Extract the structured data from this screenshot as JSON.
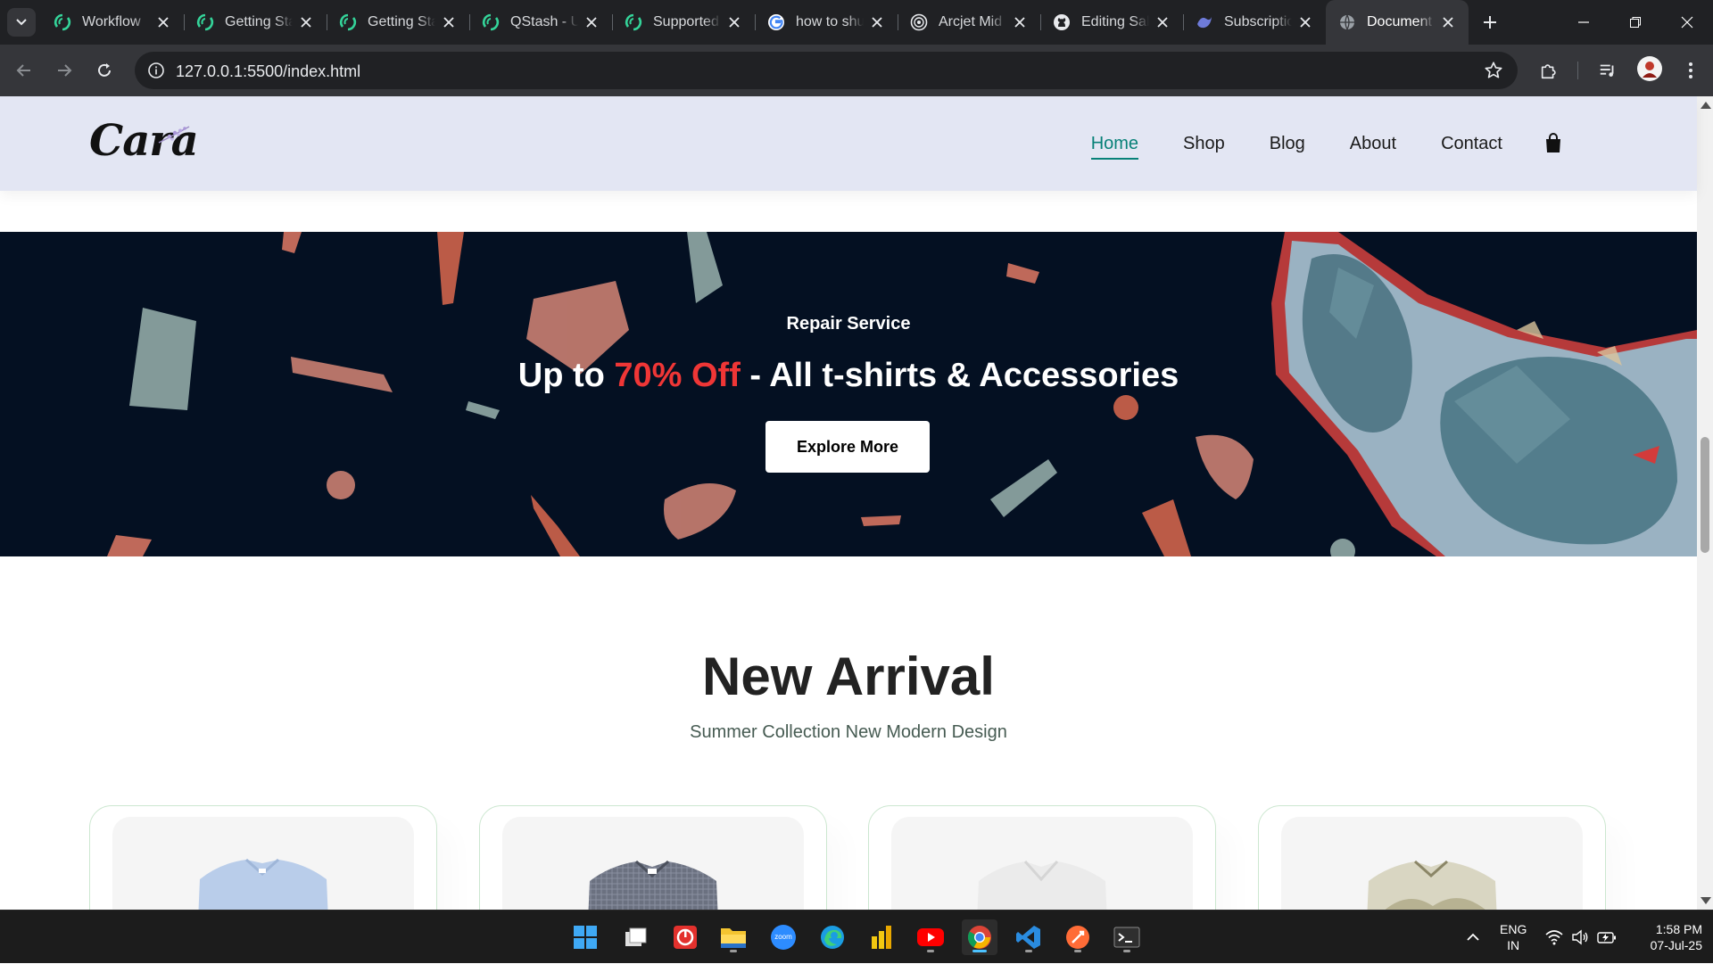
{
  "browser": {
    "tabs": [
      {
        "title": "Workflow",
        "favicon": "upstash-icon"
      },
      {
        "title": "Getting Started",
        "favicon": "upstash-icon"
      },
      {
        "title": "Getting Started",
        "favicon": "upstash-icon"
      },
      {
        "title": "QStash - U",
        "favicon": "upstash-icon"
      },
      {
        "title": "Supported",
        "favicon": "upstash-icon"
      },
      {
        "title": "how to shu",
        "favicon": "google-icon"
      },
      {
        "title": "Arcjet Mid",
        "favicon": "arcjet-icon"
      },
      {
        "title": "Editing Sal",
        "favicon": "github-icon"
      },
      {
        "title": "Subscriptio",
        "favicon": "swagger-icon"
      },
      {
        "title": "Document",
        "favicon": "globe-icon",
        "active": true
      }
    ],
    "url": "127.0.0.1:5500/index.html"
  },
  "site": {
    "logo": "Cara",
    "nav": [
      "Home",
      "Shop",
      "Blog",
      "About",
      "Contact"
    ],
    "active_nav": "Home",
    "colors": {
      "accent": "#088178",
      "header_bg": "#e3e6f3",
      "banner_bg": "#041022",
      "sale_red": "#ef3636"
    }
  },
  "banner": {
    "eyebrow": "Repair Service",
    "headline_prefix": "Up to ",
    "headline_accent": "70% Off",
    "headline_suffix": " - All t-shirts & Accessories",
    "button": "Explore More"
  },
  "new_arrival": {
    "title": "New Arrival",
    "subtitle": "Summer Collection New Modern Design",
    "products": [
      {
        "image": "light-blue-shirt",
        "color": "#b9cdea"
      },
      {
        "image": "grey-check-shirt",
        "color": "#6b7180"
      },
      {
        "image": "white-shirt",
        "color": "#ebebeb"
      },
      {
        "image": "floral-beige-shirt",
        "color": "#b7b59a"
      }
    ]
  },
  "taskbar": {
    "apps": [
      "start-icon",
      "task-view-icon",
      "anydesk-icon",
      "file-explorer-icon",
      "zoom-icon",
      "edge-icon",
      "power-bi-icon",
      "youtube-icon",
      "chrome-icon",
      "vscode-icon",
      "postman-icon",
      "terminal-icon"
    ],
    "zoom_label": "zoom",
    "language": "ENG",
    "region": "IN",
    "time": "1:58 PM",
    "date": "07-Jul-25"
  }
}
